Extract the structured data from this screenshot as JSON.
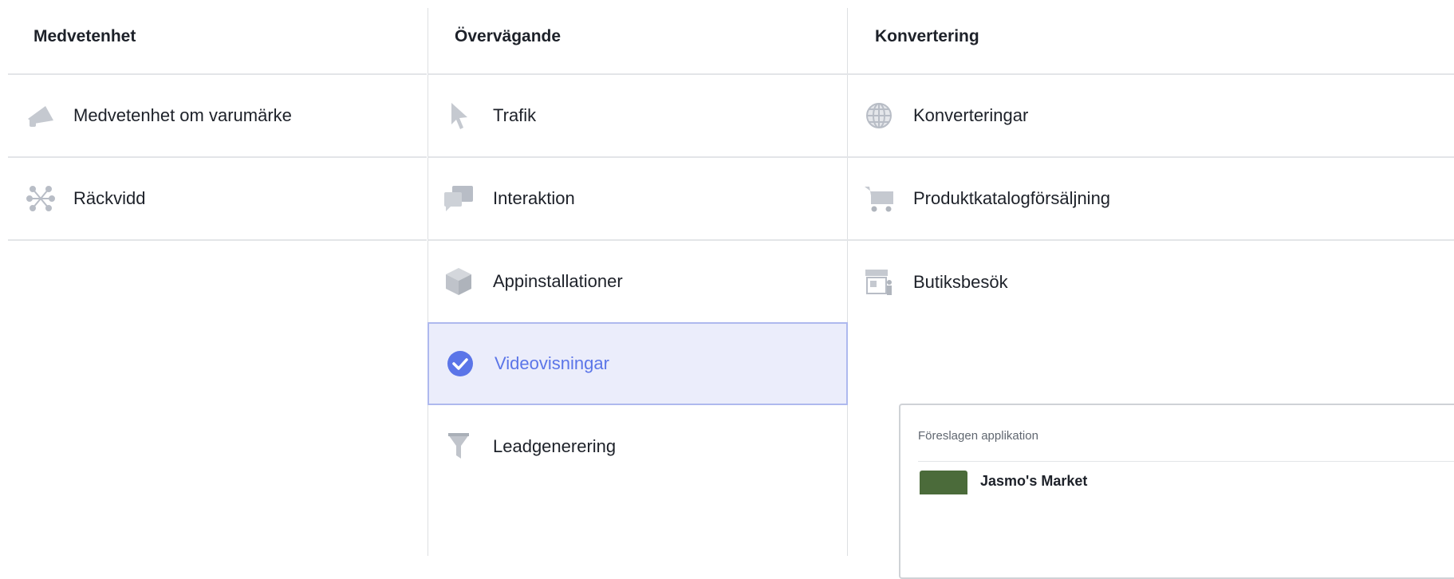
{
  "columns": [
    {
      "header": "Medvetenhet",
      "items": [
        {
          "label": "Medvetenhet om varumärke",
          "icon": "megaphone-icon"
        },
        {
          "label": "Räckvidd",
          "icon": "reach-icon"
        }
      ]
    },
    {
      "header": "Övervägande",
      "items": [
        {
          "label": "Trafik",
          "icon": "cursor-icon"
        },
        {
          "label": "Interaktion",
          "icon": "chat-bubbles-icon"
        },
        {
          "label": "Appinstallationer",
          "icon": "box-icon"
        },
        {
          "label": "Videovisningar",
          "icon": "checkmark-circle-icon",
          "selected": true
        },
        {
          "label": "Leadgenerering",
          "icon": "funnel-icon"
        }
      ]
    },
    {
      "header": "Konvertering",
      "items": [
        {
          "label": "Konverteringar",
          "icon": "globe-icon"
        },
        {
          "label": "Produktkatalogförsäljning",
          "icon": "cart-icon"
        },
        {
          "label": "Butiksbesök",
          "icon": "store-icon"
        }
      ]
    }
  ],
  "popup": {
    "title": "Föreslagen applikation",
    "app_name": "Jasmo's Market"
  },
  "colors": {
    "icon_gray": "#bcc0c6",
    "selected_blue": "#5b75e8",
    "selected_bg": "#ebedfb"
  }
}
